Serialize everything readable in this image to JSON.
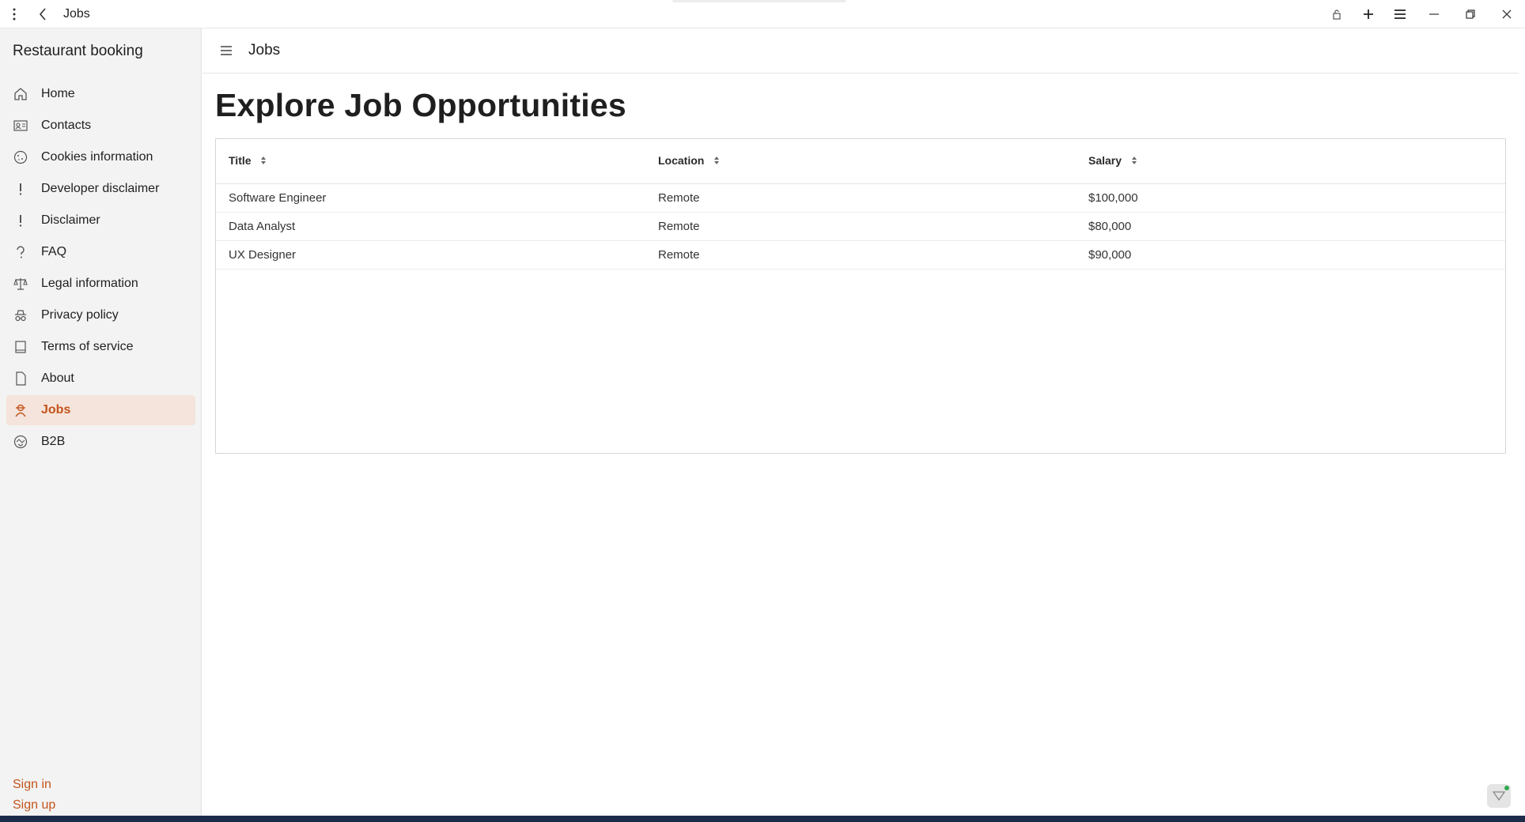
{
  "titlebar": {
    "title": "Jobs"
  },
  "sidebar": {
    "app_name": "Restaurant booking",
    "items": [
      {
        "label": "Home",
        "icon": "home-icon"
      },
      {
        "label": "Contacts",
        "icon": "contact-card-icon"
      },
      {
        "label": "Cookies information",
        "icon": "cookie-icon"
      },
      {
        "label": "Developer disclaimer",
        "icon": "exclamation-icon"
      },
      {
        "label": "Disclaimer",
        "icon": "exclamation-icon"
      },
      {
        "label": "FAQ",
        "icon": "question-icon"
      },
      {
        "label": "Legal information",
        "icon": "scales-icon"
      },
      {
        "label": "Privacy policy",
        "icon": "incognito-icon"
      },
      {
        "label": "Terms of service",
        "icon": "document-list-icon"
      },
      {
        "label": "About",
        "icon": "page-icon"
      },
      {
        "label": "Jobs",
        "icon": "worker-icon",
        "active": true
      },
      {
        "label": "B2B",
        "icon": "handshake-globe-icon"
      }
    ],
    "sign_in": "Sign in",
    "sign_up": "Sign up"
  },
  "header": {
    "title": "Jobs"
  },
  "main": {
    "heading": "Explore Job Opportunities",
    "table": {
      "columns": [
        "Title",
        "Location",
        "Salary"
      ],
      "rows": [
        [
          "Software Engineer",
          "Remote",
          "$100,000"
        ],
        [
          "Data Analyst",
          "Remote",
          "$80,000"
        ],
        [
          "UX Designer",
          "Remote",
          "$90,000"
        ]
      ]
    }
  },
  "colors": {
    "accent": "#c4541b",
    "active_bg": "#f5e4db",
    "sidebar_bg": "#f3f3f3"
  }
}
